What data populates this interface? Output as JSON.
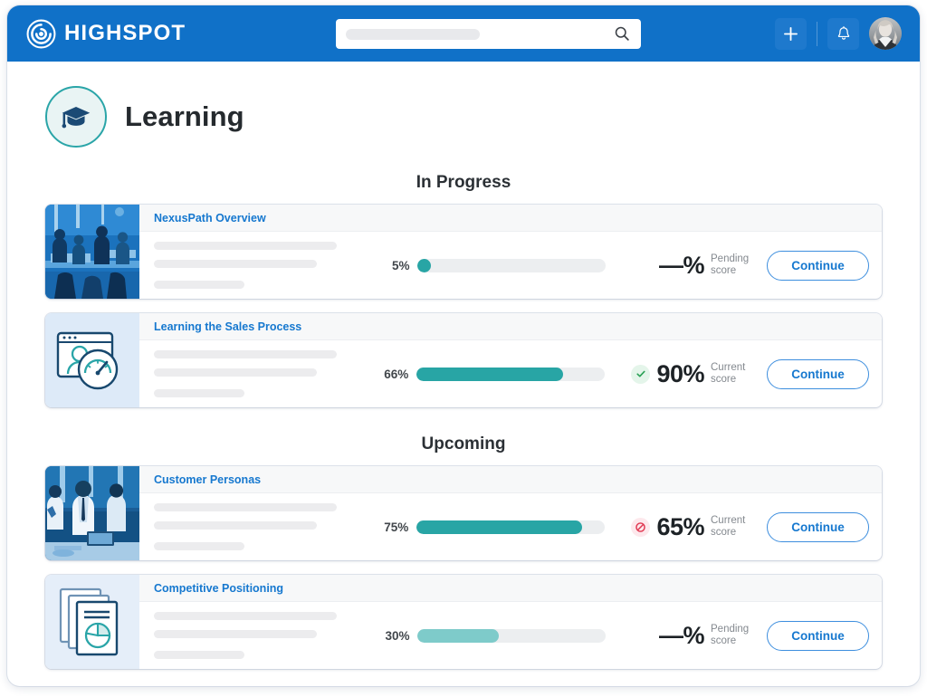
{
  "topbar": {
    "brand_name": "HIGHSPOT",
    "brand_icon": "highspot-logo-icon",
    "search_placeholder": "",
    "search_value": "",
    "search_icon": "search-icon",
    "add_icon": "plus-icon",
    "notifications_icon": "bell-icon",
    "avatar_icon": "user-avatar",
    "bg_color": "#1071c8"
  },
  "page": {
    "title": "Learning",
    "badge_icon": "graduation-cap-icon",
    "badge_border_color": "#2aa5a8",
    "badge_fill_color": "#e9f4f4"
  },
  "sections": [
    {
      "id": "in-progress",
      "title": "In Progress"
    },
    {
      "id": "upcoming",
      "title": "Upcoming"
    }
  ],
  "labels": {
    "continue": "Continue",
    "pending_score": "Pending\nscore",
    "pending_score_line1": "Pending",
    "pending_score_line2": "score",
    "current_score_line1": "Current",
    "current_score_line2": "score"
  },
  "colors": {
    "accent_blue": "#1678cf",
    "progress_teal": "#28a5a5",
    "progress_teal_light": "#7ecbca",
    "track_gray": "#eceef0",
    "success_green": "#29a155",
    "error_red": "#e0354f"
  },
  "courses": {
    "in_progress": [
      {
        "title": "NexusPath Overview",
        "thumbnail": "photo-classroom-blue-duotone",
        "progress_label": "5%",
        "progress_value": 5,
        "progress_tone": "solid",
        "score_value": "—%",
        "score_label_line1": "Pending",
        "score_label_line2": "score",
        "score_status": "none",
        "status_icon": "",
        "action_label": "Continue"
      },
      {
        "title": "Learning the Sales Process",
        "thumbnail": "illustration-browser-person-gauge",
        "progress_label": "66%",
        "progress_value": 66,
        "progress_tone": "solid",
        "score_value": "90%",
        "score_label_line1": "Current",
        "score_label_line2": "score",
        "score_status": "ok",
        "status_icon": "check-circle-icon",
        "action_label": "Continue"
      }
    ],
    "upcoming": [
      {
        "title": "Customer Personas",
        "thumbnail": "photo-meeting-blue-duotone",
        "progress_label": "75%",
        "progress_value": 75,
        "progress_tone": "solid",
        "score_value": "65%",
        "score_label_line1": "Current",
        "score_label_line2": "score",
        "score_status": "bad",
        "status_icon": "blocked-circle-icon",
        "action_label": "Continue"
      },
      {
        "title": "Competitive Positioning",
        "thumbnail": "illustration-documents-piechart",
        "progress_label": "30%",
        "progress_value": 30,
        "progress_tone": "light",
        "score_value": "—%",
        "score_label_line1": "Pending",
        "score_label_line2": "score",
        "score_status": "none",
        "status_icon": "",
        "action_label": "Continue"
      }
    ]
  }
}
